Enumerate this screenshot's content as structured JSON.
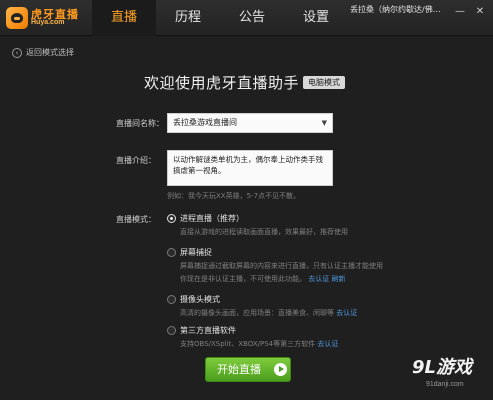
{
  "app": {
    "logo_name": "虎牙直播",
    "logo_domain": "Huya.com"
  },
  "nav": {
    "tabs": [
      "直播",
      "历程",
      "公告",
      "设置"
    ],
    "active_index": 0
  },
  "user": {
    "name": "丢拉桑（纳尔约歇达/佛…"
  },
  "window": {
    "minimize_glyph": "—",
    "close_glyph": "✕"
  },
  "back": {
    "label": "返回模式选择"
  },
  "header": {
    "title": "欢迎使用虎牙直播助手",
    "mode_badge": "电脑模式"
  },
  "form": {
    "room_name_label": "直播间名称：",
    "room_name_value": "丢拉桑游戏直播间",
    "intro_label": "直播介绍：",
    "intro_value": "以动作解谜类单机为主，偶尔奉上动作类手残搞虐第一视角。",
    "intro_hint": "例如：我今天玩XX英雄，5-7点不见不散。",
    "mode_label": "直播模式："
  },
  "modes": [
    {
      "title": "进程直播（推荐）",
      "checked": true,
      "desc_lines": [
        "直接从游戏的进程读取画面直播，效果最好，推荐使用"
      ]
    },
    {
      "title": "屏幕捕捉",
      "checked": false,
      "desc_lines": [
        "屏幕捕捉通过截取屏幕的内容来进行直播，只有认证主播才能使用",
        "你现在是非认证主播，不可使用此功能。"
      ],
      "links": [
        "去认证",
        "刷新"
      ]
    },
    {
      "title": "摄像头模式",
      "checked": false,
      "desc_lines": [
        "高清的摄像头画面，应用场景：直播美食、闲聊等"
      ],
      "links": [
        "去认证"
      ]
    },
    {
      "title": "第三方直播软件",
      "checked": false,
      "desc_lines": [
        "支持OBS/XSplit、XBOX/PS4等第三方软件"
      ],
      "links": [
        "去认证"
      ]
    }
  ],
  "start": {
    "label": "开始直播"
  },
  "watermark": {
    "brand": "9L游戏",
    "url": "91danji.com"
  }
}
